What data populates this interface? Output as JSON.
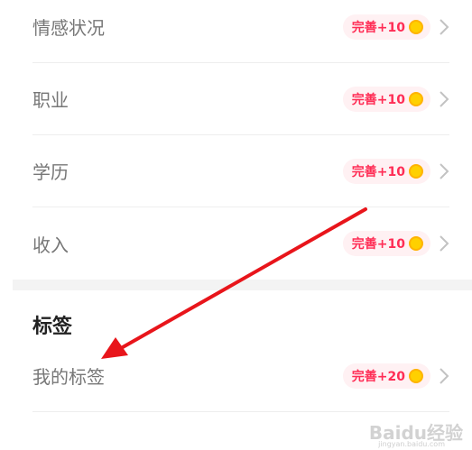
{
  "profile_rows": [
    {
      "label": "情感状况",
      "reward": "完善+10"
    },
    {
      "label": "职业",
      "reward": "完善+10"
    },
    {
      "label": "学历",
      "reward": "完善+10"
    },
    {
      "label": "收入",
      "reward": "完善+10"
    }
  ],
  "tags_section": {
    "title": "标签",
    "row": {
      "label": "我的标签",
      "reward": "完善+20"
    }
  },
  "watermark": {
    "text": "Baidu经验",
    "sub": "jingyan.baidu.com"
  },
  "colors": {
    "reward_text": "#ff2d55",
    "reward_bg": "#fff1f3",
    "coin": "#ffd000",
    "annotation_arrow": "#e8151b"
  },
  "icons": {
    "coin": "gold-coin-icon",
    "chevron": "chevron-right-icon"
  }
}
